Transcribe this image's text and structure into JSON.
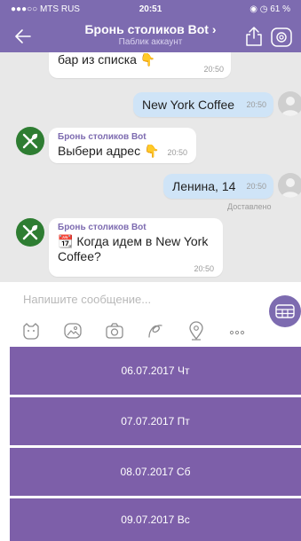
{
  "status_bar": {
    "carrier": "●●●○○ MTS RUS",
    "time": "20:51",
    "right": "61 %"
  },
  "header": {
    "title": "Бронь столиков Bot ›",
    "subtitle": "Паблик аккаунт"
  },
  "messages": [
    {
      "type": "in",
      "text": "бар из списка 👇",
      "time": "20:50"
    },
    {
      "type": "out",
      "text": "New York Coffee",
      "time": "20:50"
    },
    {
      "type": "in",
      "sender": "Бронь столиков Bot",
      "text": "Выбери адрес 👇",
      "time": "20:50"
    },
    {
      "type": "out",
      "text": "Ленина, 14",
      "time": "20:50",
      "status": "Доставлено"
    },
    {
      "type": "in",
      "sender": "Бронь столиков Bot",
      "text": "📆 Когда идем в New York Coffee?",
      "time": "20:50"
    }
  ],
  "input": {
    "placeholder": "Напишите сообщение..."
  },
  "keyboard_buttons": [
    "06.07.2017 Чт",
    "07.07.2017 Пт",
    "08.07.2017 Сб",
    "09.07.2017 Вс"
  ],
  "colors": {
    "header": "#7d6bb0",
    "button": "#7d5fa9",
    "chat_bg": "#e8e8e8",
    "outgoing_bubble": "#cfe4f7"
  }
}
